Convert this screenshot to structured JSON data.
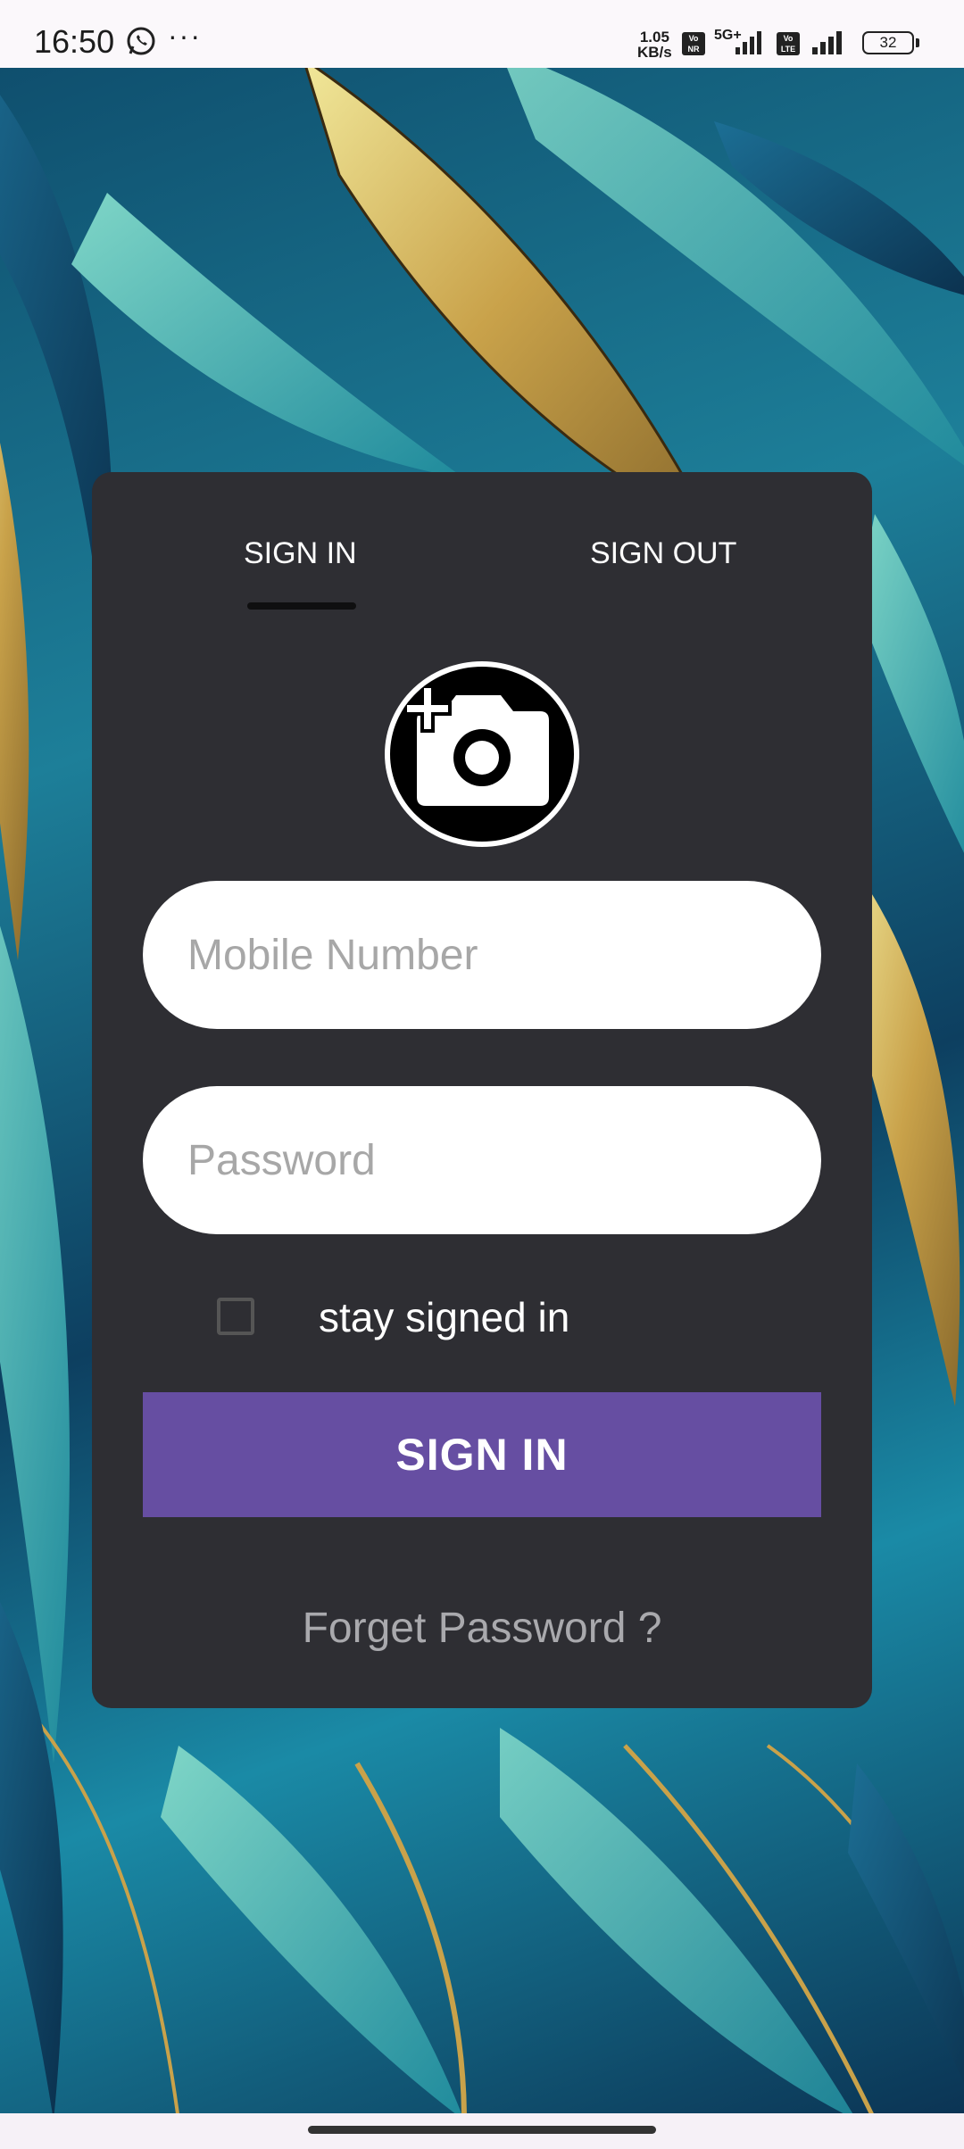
{
  "status_bar": {
    "time": "16:50",
    "more": "···",
    "net_speed_value": "1.05",
    "net_speed_unit": "KB/s",
    "vonr_badge": "Vo NR",
    "five_g": "5G+",
    "volte_badge": "Vo LTE",
    "battery": "32",
    "icons": [
      "whatsapp-icon",
      "signal-icon",
      "battery-icon"
    ]
  },
  "tabs": {
    "sign_in": "SIGN IN",
    "sign_out": "SIGN OUT",
    "active": "sign_in"
  },
  "avatar": {
    "icon": "add-photo-camera-icon"
  },
  "form": {
    "mobile_placeholder": "Mobile Number",
    "password_placeholder": "Password",
    "stay_signed_in_label": "stay signed in",
    "stay_signed_in_checked": false,
    "submit_label": "SIGN IN",
    "forget_password": "Forget Password ?"
  },
  "colors": {
    "card_bg": "#2e2e33",
    "accent": "#664ea2",
    "input_bg": "#ffffff",
    "muted_text": "#a9a9ad"
  }
}
